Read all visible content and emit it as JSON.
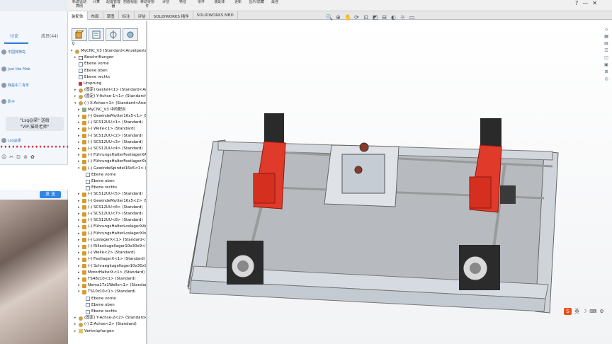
{
  "chat": {
    "tabs": [
      "讨论",
      "成员(44)"
    ],
    "messages": [
      {
        "name": "中国钟神岛"
      },
      {
        "name": "Just like Mob"
      },
      {
        "name": "我是中二青年"
      },
      {
        "name": "影子"
      }
    ],
    "system_lines": [
      "\"Lsq@梁\" 送给",
      "\"VIP-猫哥老师\""
    ],
    "last_name": "Lsq@梁",
    "gift_text": "♦♦♦♦♦♦♦♦♦♦♦♦♦♦♦♦♦♦♦♦",
    "tools": [
      "☺",
      "✂",
      "⊡",
      "⊘",
      "✿"
    ],
    "send_label": "发 送"
  },
  "solidworks": {
    "ribbon_items": [
      "新建运动算例",
      "计算",
      "配置管理器",
      "剖面视图",
      "移动零部件",
      "评估",
      "特征",
      "零件",
      "装配体",
      "更新",
      "显示/隐藏",
      "最佳"
    ],
    "command_tabs": [
      "装配体",
      "布局",
      "草图",
      "标注",
      "评估",
      "SOLIDWORKS 插件",
      "SOLIDWORKS MBD"
    ],
    "active_tab": "装配体",
    "headsup_icons": [
      "🔍",
      "⊕",
      "✋",
      "⟳",
      "⊡",
      "◩",
      "⊟",
      "◐",
      "☼",
      "▭"
    ],
    "taskpane_icons": [
      "⌂",
      "▦",
      "▤",
      "☰",
      "◫",
      "▣",
      "⊞",
      "◎"
    ],
    "tree": [
      {
        "t": "MyCNC_V3  (Standard<Anzeigestatus-",
        "d": 0,
        "ic": "asm",
        "ex": "▾"
      },
      {
        "t": "Beschriftungen",
        "d": 1,
        "ic": "note",
        "ex": "▸"
      },
      {
        "t": "Ebene vorne",
        "d": 1,
        "ic": "plane",
        "ex": ""
      },
      {
        "t": "Ebene oben",
        "d": 1,
        "ic": "plane",
        "ex": ""
      },
      {
        "t": "Ebene rechts",
        "d": 1,
        "ic": "plane",
        "ex": ""
      },
      {
        "t": "Ursprung",
        "d": 1,
        "ic": "origin",
        "ex": ""
      },
      {
        "t": "(固定) Gestell<1> (Standard<Anze",
        "d": 1,
        "ic": "asm",
        "ex": "▸"
      },
      {
        "t": "(固定) Y-Achse-1<1> (Standard<Anz",
        "d": 1,
        "ic": "asm",
        "ex": "▸"
      },
      {
        "t": "(-) X-Achse<1> (Standard<Anzeig",
        "d": 1,
        "ic": "asm",
        "ex": "▾"
      },
      {
        "t": "MyCNC_V3 中的配合",
        "d": 2,
        "ic": "mate",
        "ex": "▸"
      },
      {
        "t": "(-) GewindeMutter16x5<1> (St",
        "d": 2,
        "ic": "part",
        "ex": "▸"
      },
      {
        "t": "(-) SCS12UU<1> (Standard)",
        "d": 2,
        "ic": "part",
        "ex": "▸"
      },
      {
        "t": "(-) Welle<1> (Standard)",
        "d": 2,
        "ic": "part",
        "ex": "▸"
      },
      {
        "t": "(-) SCS12UU<2> (Standard)",
        "d": 2,
        "ic": "part",
        "ex": "▸"
      },
      {
        "t": "(-) SCS12UU<3> (Standard)",
        "d": 2,
        "ic": "part",
        "ex": "▸"
      },
      {
        "t": "(-) SCS12UU<4> (Standard)",
        "d": 2,
        "ic": "part",
        "ex": "▸"
      },
      {
        "t": "(-) FührungsHalterFestlagerXA",
        "d": 2,
        "ic": "part",
        "ex": "▸"
      },
      {
        "t": "(-) FührungsHalterFestlagerXln",
        "d": 2,
        "ic": "part",
        "ex": "▸"
      },
      {
        "t": "(-) GewindeSpindel16x5<1> (S",
        "d": 2,
        "ic": "part",
        "ex": "▾"
      },
      {
        "t": "Ebene vorne",
        "d": 3,
        "ic": "plane",
        "ex": ""
      },
      {
        "t": "Ebene oben",
        "d": 3,
        "ic": "plane",
        "ex": ""
      },
      {
        "t": "Ebene rechts",
        "d": 3,
        "ic": "plane",
        "ex": ""
      },
      {
        "t": "(-) SCS12UU<5> (Standard)",
        "d": 2,
        "ic": "part",
        "ex": "▸"
      },
      {
        "t": "(-) GewindeMutter16x5<2> (St",
        "d": 2,
        "ic": "part",
        "ex": "▸"
      },
      {
        "t": "(-) SCS12UU<6> (Standard)",
        "d": 2,
        "ic": "part",
        "ex": "▸"
      },
      {
        "t": "(-) SCS12UU<7> (Standard)",
        "d": 2,
        "ic": "part",
        "ex": "▸"
      },
      {
        "t": "(-) SCS12UU<8> (Standard)",
        "d": 2,
        "ic": "part",
        "ex": "▸"
      },
      {
        "t": "(-) FührungsHalterLoslagerXAu",
        "d": 2,
        "ic": "part",
        "ex": "▸"
      },
      {
        "t": "(-) FührungsHalterLoslagerXInr",
        "d": 2,
        "ic": "part",
        "ex": "▸"
      },
      {
        "t": "(-) LoslagerX<1> (Standard<<",
        "d": 2,
        "ic": "part",
        "ex": "▸"
      },
      {
        "t": "(-) Rillenkugellager10x30x9<1",
        "d": 2,
        "ic": "part",
        "ex": "▸"
      },
      {
        "t": "(-) Welle<2> (Standard)",
        "d": 2,
        "ic": "part",
        "ex": "▸"
      },
      {
        "t": "(-) FestlagerX<1> (Standard)",
        "d": 2,
        "ic": "part",
        "ex": "▸"
      },
      {
        "t": "(-) Schraegkugellager10x30x9",
        "d": 2,
        "ic": "part",
        "ex": "▸"
      },
      {
        "t": "MotorHalterX<1> (Standard)",
        "d": 2,
        "ic": "part",
        "ex": "▸"
      },
      {
        "t": "TS48z10<1> (Standard)",
        "d": 2,
        "ic": "part",
        "ex": "▸"
      },
      {
        "t": "Nema17x1Welle<1> (Standard)",
        "d": 2,
        "ic": "part",
        "ex": "▸"
      },
      {
        "t": "TS10z10<1> (Standard)",
        "d": 2,
        "ic": "part",
        "ex": "▾"
      },
      {
        "t": "Ebene vorne",
        "d": 3,
        "ic": "plane",
        "ex": ""
      },
      {
        "t": "Ebene oben",
        "d": 3,
        "ic": "plane",
        "ex": ""
      },
      {
        "t": "Ebene rechts",
        "d": 3,
        "ic": "plane",
        "ex": ""
      },
      {
        "t": "(固定) Y-Achse-2<2> (Standard<An",
        "d": 1,
        "ic": "asm",
        "ex": "▸"
      },
      {
        "t": "(-) Z-Achse<2> (Standard)",
        "d": 1,
        "ic": "asm",
        "ex": "▸"
      },
      {
        "t": "Verknüpfungen",
        "d": 1,
        "ic": "folder",
        "ex": "▸"
      }
    ],
    "ime_icons": [
      "S",
      "英",
      "☽",
      "⌨",
      "⚙"
    ],
    "window_controls": [
      "?",
      "—",
      "✕"
    ]
  },
  "colors": {
    "accent": "#2f7bdc",
    "part_red": "#e03a2a",
    "rail": "#c7ced6"
  }
}
